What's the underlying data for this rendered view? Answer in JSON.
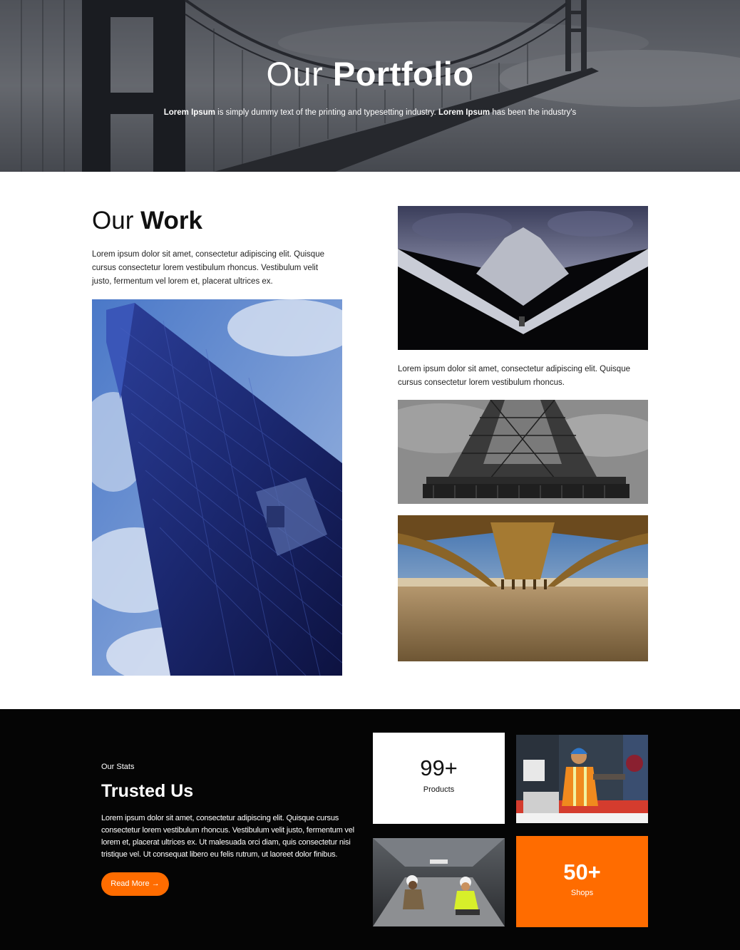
{
  "hero": {
    "title_light": "Our",
    "title_bold": "Portfolio",
    "sub_bold1": "Lorem Ipsum",
    "sub_text1": " is simply dummy text of the printing and typesetting industry. ",
    "sub_bold2": "Lorem Ipsum",
    "sub_text2": " has been the industry's",
    "image": "golden-gate-bridge-fog"
  },
  "work": {
    "title_light": "Our",
    "title_bold": "Work",
    "description": "Lorem ipsum dolor sit amet, consectetur adipiscing elit. Quisque cursus consectetur lorem vestibulum rhoncus. Vestibulum velit justo, fermentum vel lorem et, placerat ultrices ex.",
    "caption": "Lorem ipsum dolor sit amet, consectetur adipiscing elit. Quisque cursus consectetur lorem vestibulum rhoncus.",
    "images": [
      "glass-skyscraper",
      "tent-roof-structure",
      "eiffel-tower-base",
      "pier-underside-beach"
    ]
  },
  "stats": {
    "eyebrow": "Our Stats",
    "title": "Trusted Us",
    "description": "Lorem ipsum dolor sit amet, consectetur adipiscing elit. Quisque cursus consectetur lorem vestibulum rhoncus. Vestibulum velit justo, fermentum vel lorem et, placerat ultrices ex. Ut malesuada orci diam, quis consectetur nisi tristique vel. Ut consequat libero eu felis rutrum, ut laoreet dolor finibus.",
    "button_label": "Read More →",
    "cards": [
      {
        "number": "99+",
        "label": "Products"
      },
      {
        "number": "50+",
        "label": "Shops"
      }
    ],
    "images": [
      "construction-worker",
      "workers-inspecting-floor"
    ],
    "accent": "#ff6c00"
  }
}
